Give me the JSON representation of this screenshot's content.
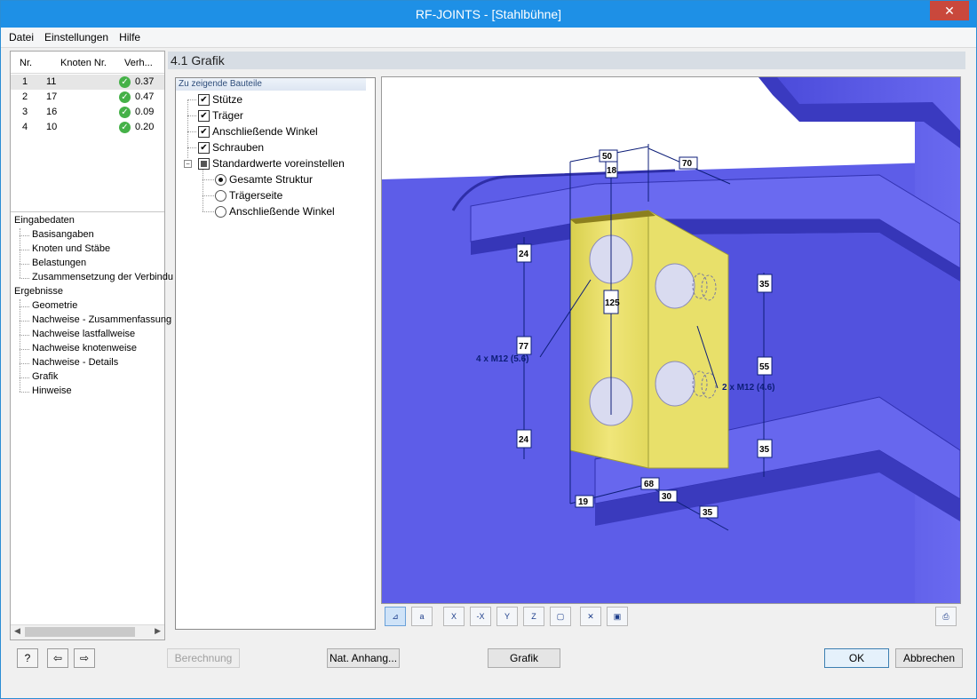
{
  "window": {
    "title": "RF-JOINTS - [Stahlbühne]",
    "close_glyph": "✕"
  },
  "menu": [
    "Datei",
    "Einstellungen",
    "Hilfe"
  ],
  "node_table": {
    "columns": [
      "Nr.",
      "Knoten Nr.",
      "Verh..."
    ],
    "rows": [
      {
        "nr": "1",
        "knoten": "11",
        "ratio": "0.37"
      },
      {
        "nr": "2",
        "knoten": "17",
        "ratio": "0.47"
      },
      {
        "nr": "3",
        "knoten": "16",
        "ratio": "0.09"
      },
      {
        "nr": "4",
        "knoten": "10",
        "ratio": "0.20"
      }
    ],
    "status_icon": "check-icon",
    "status_color": "#45b148"
  },
  "nav": {
    "input_header": "Eingabedaten",
    "input_items": [
      "Basisangaben",
      "Knoten und Stäbe",
      "Belastungen",
      "Zusammensetzung der Verbindu"
    ],
    "results_header": "Ergebnisse",
    "results_items": [
      "Geometrie",
      "Nachweise - Zusammenfassung",
      "Nachweise lastfallweise",
      "Nachweise knotenweise",
      "Nachweise - Details",
      "Grafik",
      "Hinweise"
    ]
  },
  "section_title": "4.1 Grafik",
  "components": {
    "tab_label": "Zu zeigende Bauteile",
    "checkboxes": [
      {
        "label": "Stütze",
        "checked": true
      },
      {
        "label": "Träger",
        "checked": true
      },
      {
        "label": "Anschließende Winkel",
        "checked": true
      },
      {
        "label": "Schrauben",
        "checked": true
      },
      {
        "label": "Standardwerte voreinstellen",
        "checked": "partial"
      }
    ],
    "radios": [
      {
        "label": "Gesamte Struktur",
        "selected": true
      },
      {
        "label": "Trägerseite",
        "selected": false
      },
      {
        "label": "Anschließende Winkel",
        "selected": false
      }
    ]
  },
  "graphic": {
    "colors": {
      "steel": "#5b5be6",
      "steel_dark": "#2f2f9e",
      "angle": "#e8e06a",
      "bolt": "#d9dbf0",
      "dim": "#0d1e78"
    },
    "dimensions": [
      "50",
      "18",
      "70",
      "24",
      "125",
      "35",
      "77",
      "55",
      "24",
      "35",
      "19",
      "68",
      "30",
      "35"
    ],
    "bolt_label_left": "4 x M12 (5.6)",
    "bolt_label_right": "2 x M12 (4.6)"
  },
  "view_toolbar": [
    "dimension-icon",
    "annotation-icon",
    "view-x-icon",
    "view-minus-x-icon",
    "view-y-icon",
    "view-z-icon",
    "isometric-icon",
    "zoom-reset-icon",
    "copy-view-icon",
    "print-icon"
  ],
  "view_toolbar_glyphs": [
    "⊿",
    "a",
    "X",
    "-X",
    "Y",
    "Z",
    "▢",
    "✕",
    "▣",
    "⎙"
  ],
  "buttons": {
    "berechnung": "Berechnung",
    "nat_anhang": "Nat. Anhang...",
    "grafik": "Grafik",
    "ok": "OK",
    "abbrechen": "Abbrechen",
    "help_glyph": "?",
    "import_glyph": "⇦",
    "export_glyph": "⇨"
  }
}
